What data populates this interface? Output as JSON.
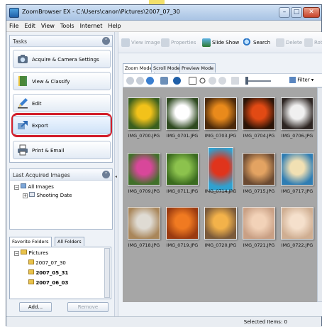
{
  "window": {
    "title": "ZoomBrowser EX - C:\\Users\\canon\\Pictures\\2007_07_30",
    "buttons": {
      "minimize": "–",
      "maximize": "□",
      "close": "✕"
    }
  },
  "menu": [
    "File",
    "Edit",
    "View",
    "Tools",
    "Internet",
    "Help"
  ],
  "tasks": {
    "header": "Tasks",
    "items": [
      {
        "label": "Acquire & Camera Settings",
        "icon": "camera-icon"
      },
      {
        "label": "View & Classify",
        "icon": "folder-icon"
      },
      {
        "label": "Edit",
        "icon": "pencil-icon"
      },
      {
        "label": "Export",
        "icon": "export-icon"
      },
      {
        "label": "Print & Email",
        "icon": "printer-icon"
      }
    ]
  },
  "last_acquired": {
    "header": "Last Acquired Images",
    "tree": [
      "All Images",
      "Shooting Date"
    ]
  },
  "folders": {
    "tabs": [
      "Favorite Folders",
      "All Folders"
    ],
    "tree": [
      "Pictures",
      "2007_07_30",
      "2007_05_31",
      "2007_06_03"
    ],
    "add_label": "Add...",
    "remove_label": "Remove"
  },
  "toolbar": {
    "view_image": "View Image",
    "properties": "Properties",
    "slide_show": "Slide Show",
    "search": "Search",
    "delete": "Delete",
    "rotate": "Rota"
  },
  "view_tabs": [
    "Zoom Mode",
    "Scroll Mode",
    "Preview Mode"
  ],
  "filter_label": "Filter",
  "images": [
    {
      "name": "IMG_0700.JPG",
      "c1": "#f2c21a",
      "c2": "#3a5f1f"
    },
    {
      "name": "IMG_0701.JPG",
      "c1": "#ffffff",
      "c2": "#2f4a20"
    },
    {
      "name": "IMG_0703.JPG",
      "c1": "#e98a1b",
      "c2": "#4c2a0c"
    },
    {
      "name": "IMG_0704.JPG",
      "c1": "#e24a14",
      "c2": "#2b1407"
    },
    {
      "name": "IMG_0706.JPG",
      "c1": "#f0f0f0",
      "c2": "#2d2522"
    },
    {
      "name": "IMG_0709.JPG",
      "c1": "#d8479a",
      "c2": "#41702a"
    },
    {
      "name": "IMG_0711.JPG",
      "c1": "#8cc24d",
      "c2": "#3b6b1f"
    },
    {
      "name": "IMG_0714.JPG",
      "c1": "#e0341c",
      "c2": "#2fa1d0"
    },
    {
      "name": "IMG_0715.JPG",
      "c1": "#e3a362",
      "c2": "#6b4a32"
    },
    {
      "name": "IMG_0717.JPG",
      "c1": "#f1e0b3",
      "c2": "#2f7db3"
    },
    {
      "name": "IMG_0718.JPG",
      "c1": "#dfdbd3",
      "c2": "#a9865a"
    },
    {
      "name": "IMG_0719.JPG",
      "c1": "#f07a21",
      "c2": "#9a3a10"
    },
    {
      "name": "IMG_0720.JPG",
      "c1": "#f3b24a",
      "c2": "#7b5a3a"
    },
    {
      "name": "IMG_0721.JPG",
      "c1": "#f2d2b8",
      "c2": "#c9a085"
    },
    {
      "name": "IMG_0722.JPG",
      "c1": "#f5e0cc",
      "c2": "#cfae92"
    }
  ],
  "status": {
    "selected": "Selected Items: 0"
  }
}
